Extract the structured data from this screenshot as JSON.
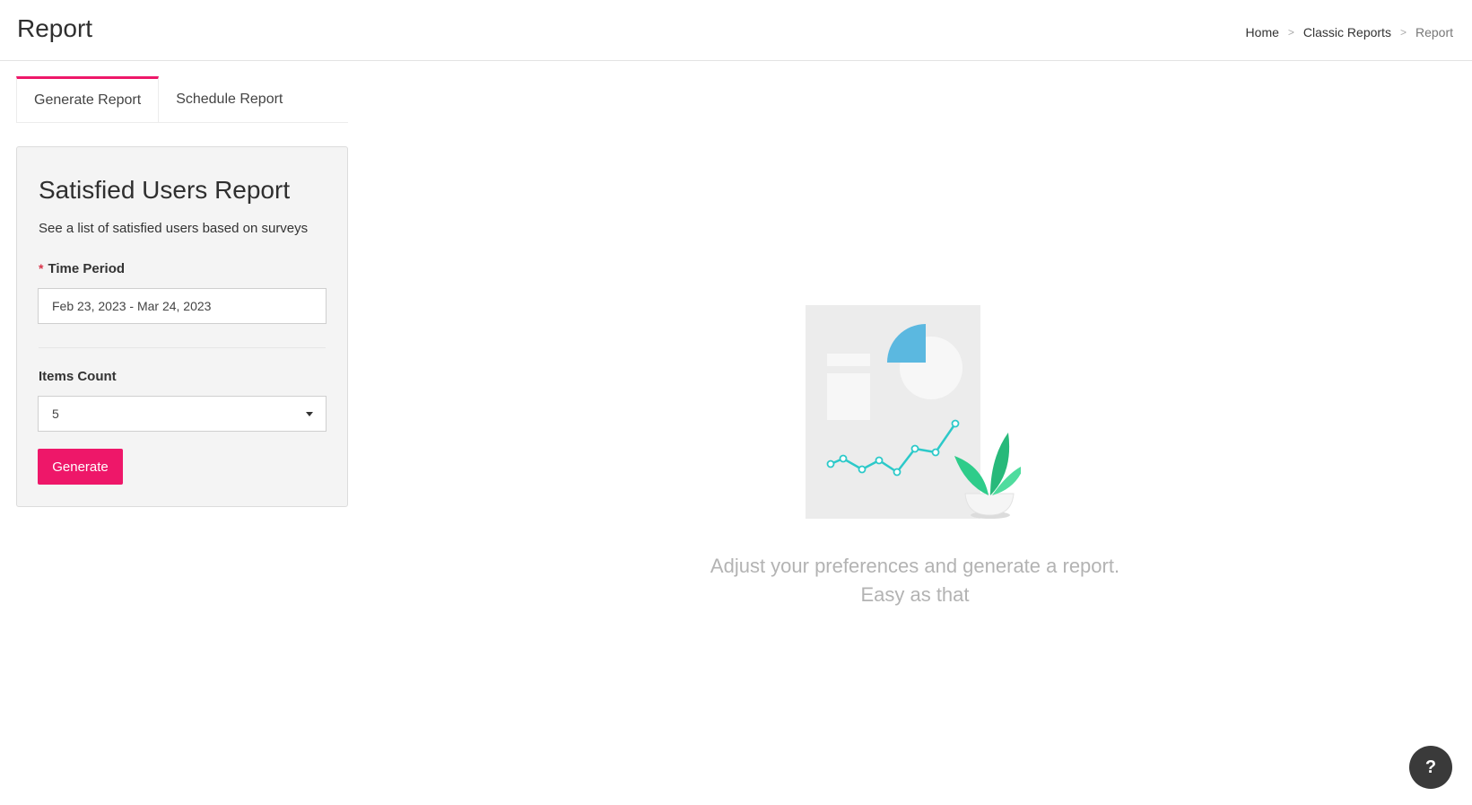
{
  "header": {
    "title": "Report",
    "breadcrumb": {
      "home": "Home",
      "separator": ">",
      "classic_reports": "Classic Reports",
      "current": "Report"
    }
  },
  "tabs": [
    {
      "label": "Generate Report",
      "active": true
    },
    {
      "label": "Schedule Report",
      "active": false
    }
  ],
  "form": {
    "title": "Satisfied Users Report",
    "subtitle": "See a list of satisfied users based on surveys",
    "time_period": {
      "required_mark": "*",
      "label": "Time Period",
      "value": "Feb 23, 2023 - Mar 24, 2023"
    },
    "items_count": {
      "label": "Items Count",
      "value": "5"
    },
    "generate_label": "Generate"
  },
  "empty_state": {
    "line1": "Adjust your preferences and generate a report.",
    "line2": "Easy as that"
  },
  "help": {
    "label": "?"
  },
  "colors": {
    "accent": "#ee1769",
    "panel_bg": "#f4f4f4",
    "chart_line": "#2cc9c9",
    "pie_fill": "#5bb8e0",
    "plant_green": "#2ecc8a"
  }
}
